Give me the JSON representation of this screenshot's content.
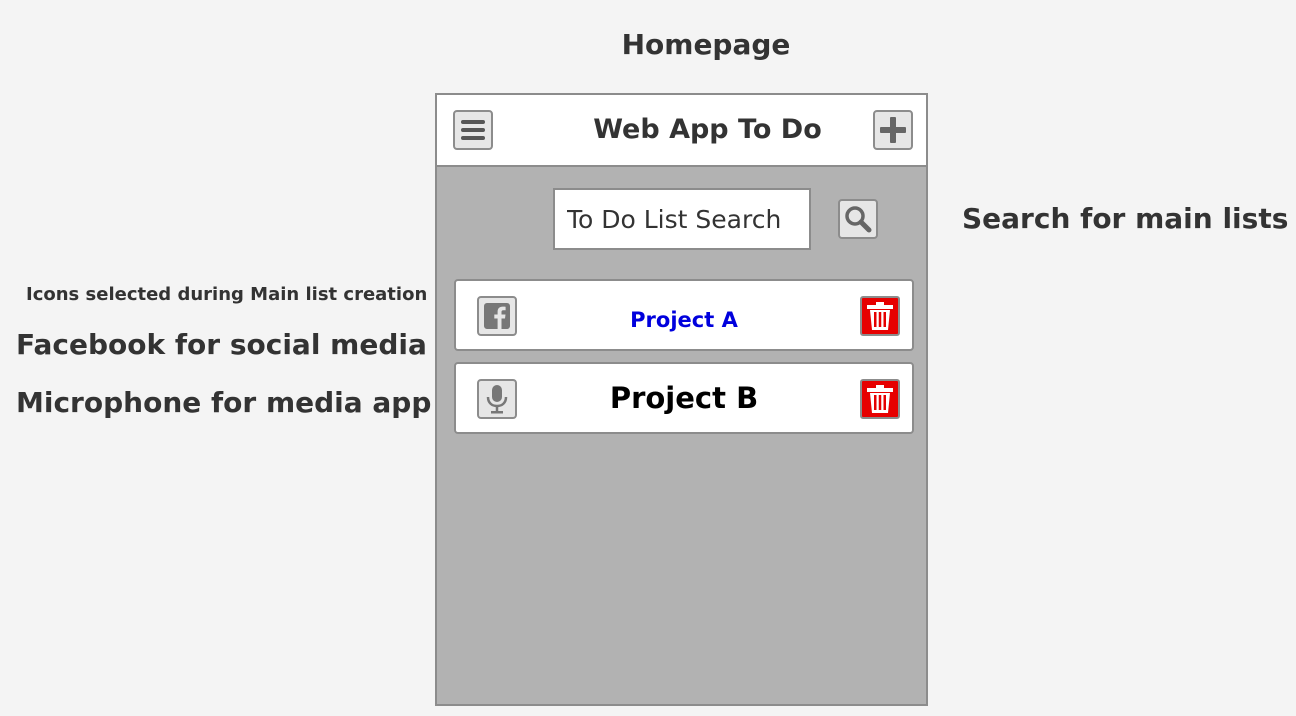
{
  "page_title": "Homepage",
  "annotations": {
    "icons_note": "Icons selected during Main list creation",
    "facebook_note": "Facebook for social media app",
    "microphone_note": "Microphone for media app",
    "search_note": "Search for main lists"
  },
  "app": {
    "title": "Web App To Do",
    "menu_icon": "hamburger-menu-icon",
    "add_icon": "plus-icon",
    "search": {
      "value": "To Do List Search",
      "icon": "magnifier-icon"
    },
    "lists": [
      {
        "label": "Project A",
        "icon": "facebook-icon",
        "color": "#0000dd",
        "delete_icon": "trash-icon"
      },
      {
        "label": "Project B",
        "icon": "microphone-icon",
        "color": "#000000",
        "delete_icon": "trash-icon"
      }
    ]
  },
  "colors": {
    "page_bg": "#f4f4f4",
    "panel_bg": "#b2b2b2",
    "border": "#8c8c8c",
    "delete_red": "#e60000",
    "link_blue": "#0000dd"
  }
}
